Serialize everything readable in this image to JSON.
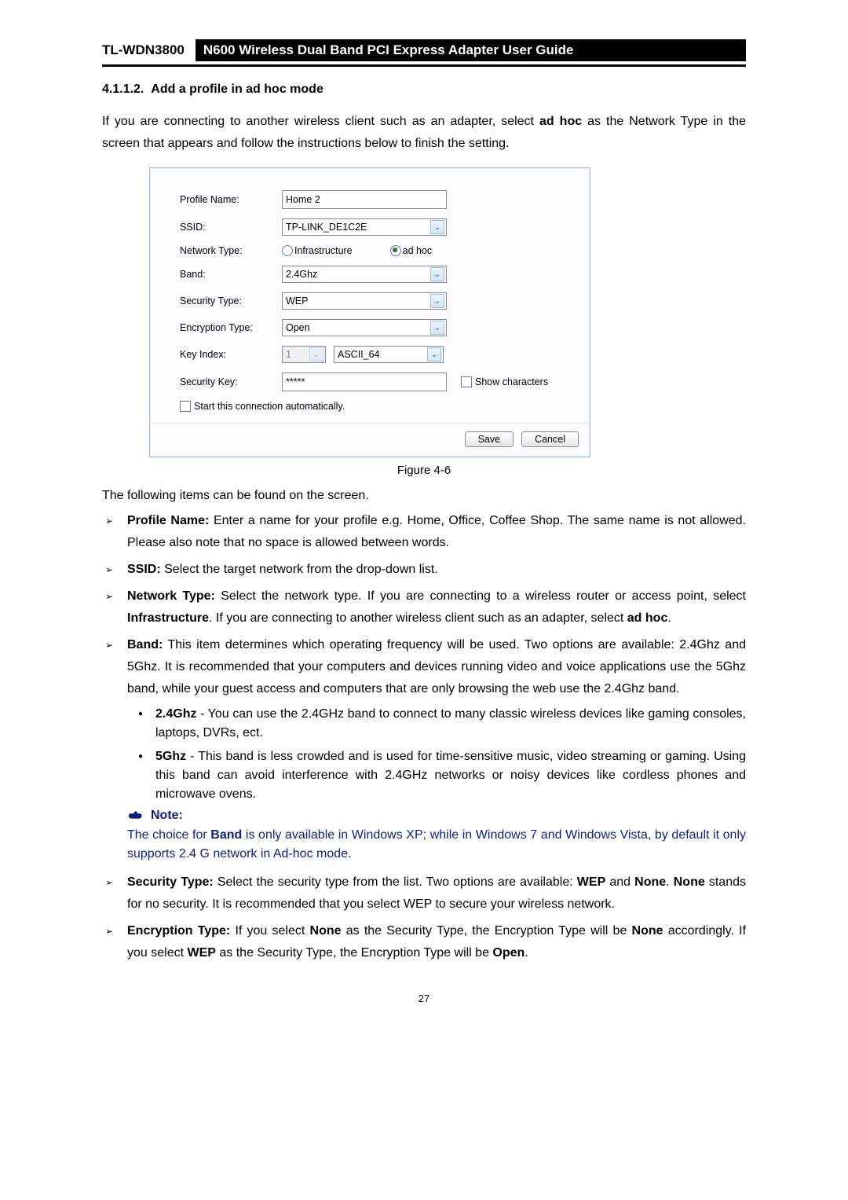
{
  "header": {
    "model": "TL-WDN3800",
    "title": "N600 Wireless Dual Band PCI Express Adapter User Guide"
  },
  "section": {
    "number": "4.1.1.2.",
    "title": "Add a profile in ad hoc mode"
  },
  "intro_part1": "If you are connecting to another wireless client such as an adapter, select ",
  "intro_bold": "ad hoc",
  "intro_part2": " as the Network Type in the screen that appears and follow the instructions below to finish the setting.",
  "figure_caption": "Figure 4-6",
  "dialog": {
    "labels": {
      "profile_name": "Profile Name:",
      "ssid": "SSID:",
      "network_type": "Network Type:",
      "band": "Band:",
      "security_type": "Security Type:",
      "encryption_type": "Encryption Type:",
      "key_index": "Key Index:",
      "security_key": "Security Key:"
    },
    "values": {
      "profile_name": "Home 2",
      "ssid": "TP-LINK_DE1C2E",
      "radio_infra": "Infrastructure",
      "radio_adhoc": "ad hoc",
      "band": "2.4Ghz",
      "security_type": "WEP",
      "encryption_type": "Open",
      "key_index": "1",
      "key_format": "ASCII_64",
      "security_key": "*****",
      "show_characters": "Show characters",
      "auto_start": "Start this connection automatically."
    },
    "buttons": {
      "save": "Save",
      "cancel": "Cancel"
    }
  },
  "list_intro": "The following items can be found on the screen.",
  "bullets": {
    "profile_name_label": "Profile Name:",
    "profile_name_text": " Enter a name for your profile e.g. Home, Office, Coffee Shop. The same name is not allowed. Please also note that no space is allowed between words.",
    "ssid_label": "SSID:",
    "ssid_text": " Select the target network from the drop-down list.",
    "network_type_label": "Network Type:",
    "network_type_text1": " Select the network type. If you are connecting to a wireless router or access point, select ",
    "network_type_bold1": "Infrastructure",
    "network_type_text2": ". If you are connecting to another wireless client such as an adapter, select ",
    "network_type_bold2": "ad hoc",
    "network_type_text3": ".",
    "band_label": "Band:",
    "band_text": " This item determines which operating frequency will be used. Two options are available: 2.4Ghz and 5Ghz. It is recommended that your computers and devices running video and voice applications use the 5Ghz band, while your guest access and computers that are only browsing the web use the 2.4Ghz band.",
    "sub24_label": "2.4Ghz",
    "sub24_text": " - You can use the 2.4GHz band to connect to many classic wireless devices like gaming consoles, laptops, DVRs, ect.",
    "sub5_label": "5Ghz",
    "sub5_text": " - This band is less crowded and is used for time-sensitive music, video streaming or gaming. Using this band can avoid interference with 2.4GHz networks or noisy devices like cordless phones and microwave ovens.",
    "security_type_label": "Security Type:",
    "security_type_text1": " Select the security type from the list. Two options are available: ",
    "security_type_bold1": "WEP",
    "security_type_text2": " and ",
    "security_type_bold2": "None",
    "security_type_text3": ". ",
    "security_type_bold3": "None",
    "security_type_text4": " stands for no security. It is recommended that you select WEP to secure your wireless network.",
    "encryption_type_label": "Encryption Type:",
    "encryption_type_text1": " If you select ",
    "encryption_type_bold1": "None",
    "encryption_type_text2": " as the Security Type, the Encryption Type will be ",
    "encryption_type_bold2": "None",
    "encryption_type_text3": " accordingly. If you select ",
    "encryption_type_bold3": "WEP",
    "encryption_type_text4": " as the Security Type, the Encryption Type will be ",
    "encryption_type_bold4": "Open",
    "encryption_type_text5": "."
  },
  "note": {
    "head": "Note:",
    "text_part1": "The choice for ",
    "text_bold": "Band",
    "text_part2": " is only available in Windows XP; while in Windows 7 and Windows Vista, by default it only supports 2.4 G network in Ad-hoc mode."
  },
  "page_number": "27"
}
